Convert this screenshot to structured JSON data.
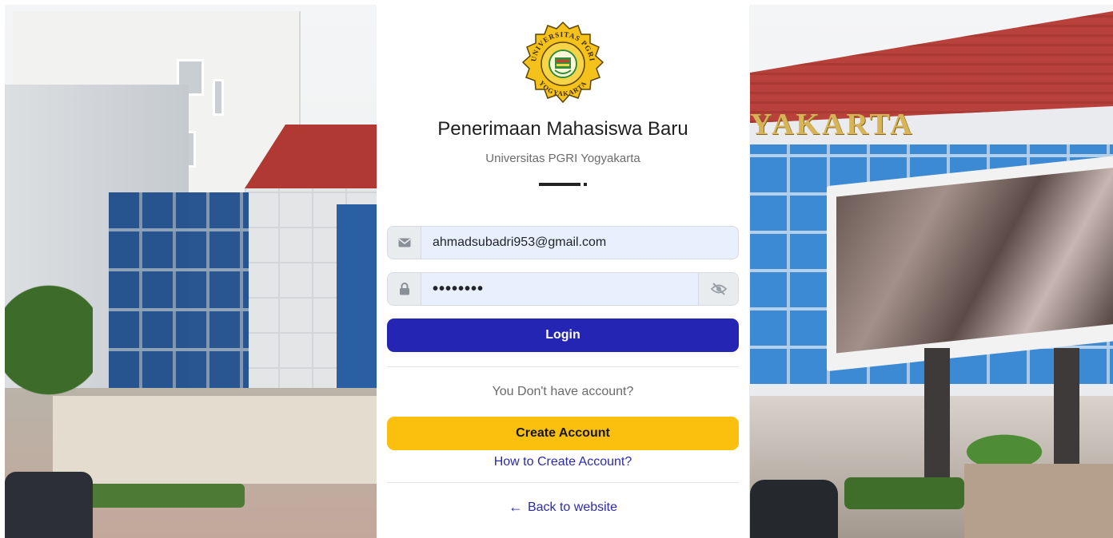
{
  "header": {
    "logo": {
      "top_text": "UNIVERSITAS PGRI",
      "bottom_text": "YOGYAKARTA",
      "colors": {
        "ring": "#f5c21b",
        "inner": "#f7d347",
        "text": "#3a2a00",
        "emblem_green": "#2f8f3a",
        "emblem_red": "#d23a2e"
      }
    },
    "title": "Penerimaan Mahasiswa Baru",
    "subtitle": "Universitas PGRI Yogyakarta"
  },
  "form": {
    "email": {
      "icon": "envelope-icon",
      "value": "ahmadsubadri953@gmail.com"
    },
    "password": {
      "icon": "lock-icon",
      "masked_value": "••••••••",
      "toggle_icon": "eye-slash-icon"
    },
    "login_label": "Login",
    "no_account_prompt": "You Don't have account?",
    "create_account_label": "Create Account",
    "how_to_label": "How to Create Account?",
    "back_label": "Back to website"
  },
  "background": {
    "sign_text": "YAKARTA"
  },
  "colors": {
    "primary": "#2525b4",
    "warning": "#fbc00e",
    "link": "#2b2ba8"
  }
}
